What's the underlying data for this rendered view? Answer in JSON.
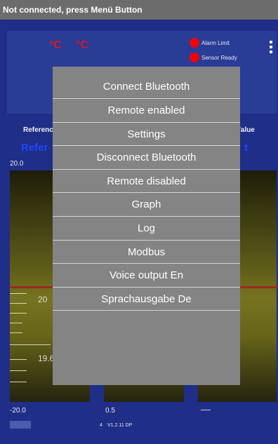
{
  "status_bar": {
    "text": "Not connected, press Menü Button"
  },
  "header": {
    "unit_1": "°C",
    "unit_2": "°C",
    "alarm_label": "Alarm Limit",
    "sensor_label": "Sensor Ready",
    "led_color": "#f00000"
  },
  "reference": {
    "left_label": "Referenc",
    "right_label": "/alue",
    "left_value": "Refer",
    "right_value": "t",
    "value_color": "#1d48ff"
  },
  "gauge": {
    "scale_max": "20.0",
    "scale_min": "-20.0",
    "tick_label_1": "20",
    "tick_label_2": "19.6"
  },
  "footer": {
    "mid_value": "0.5",
    "num": "4",
    "version": "V1.2.11 DP"
  },
  "menu": {
    "items": [
      "Connect Bluetooth",
      "Remote enabled",
      "Settings",
      "Disconnect Bluetooth",
      "Remote disabled",
      "Graph",
      "Log",
      "Modbus",
      "Voice output En",
      "Sprachausgabe De"
    ]
  },
  "colors": {
    "background": "#1f2e86",
    "status_bar": "#6c6c6c",
    "menu": "#848484",
    "unit_red": "#e0151f"
  }
}
